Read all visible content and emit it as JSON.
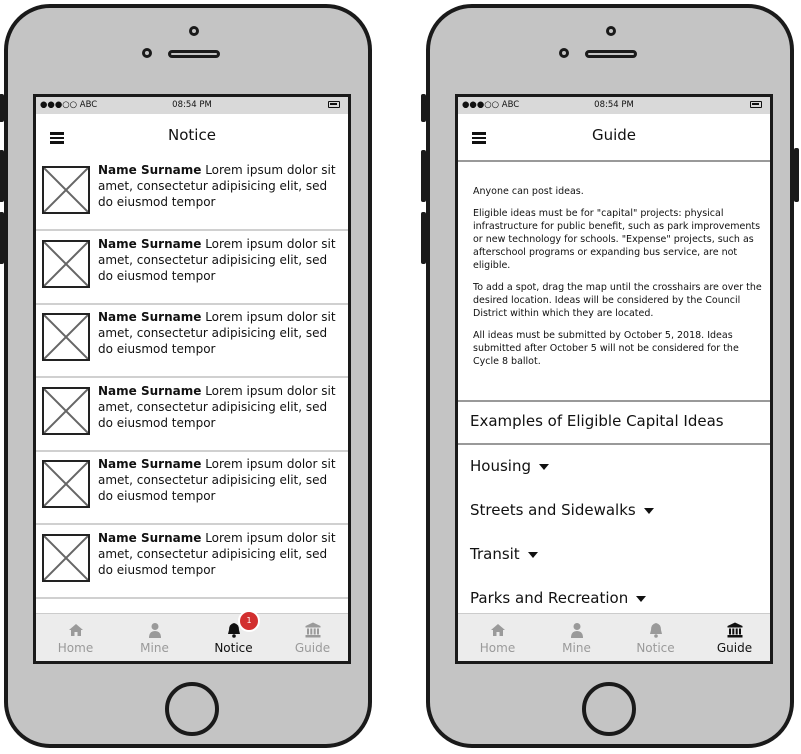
{
  "left_phone": {
    "status": {
      "carrier": "●●●○○ ABC",
      "time": "08:54 PM"
    },
    "title": "Notice",
    "items": [
      {
        "name": "Name Surname",
        "text": "Lorem ipsum dolor sit amet, consectetur adipisicing elit, sed do eiusmod tempor"
      },
      {
        "name": "Name Surname",
        "text": "Lorem ipsum dolor sit amet, consectetur adipisicing elit, sed do eiusmod tempor"
      },
      {
        "name": "Name Surname",
        "text": "Lorem ipsum dolor sit amet, consectetur adipisicing elit, sed do eiusmod tempor"
      },
      {
        "name": "Name Surname",
        "text": "Lorem ipsum dolor sit amet, consectetur adipisicing elit, sed do eiusmod tempor"
      },
      {
        "name": "Name Surname",
        "text": "Lorem ipsum dolor sit amet, consectetur adipisicing elit, sed do eiusmod tempor"
      },
      {
        "name": "Name Surname",
        "text": "Lorem ipsum dolor sit amet, consectetur adipisicing elit, sed do eiusmod tempor"
      }
    ],
    "tabs": [
      {
        "label": "Home",
        "icon": "home-icon"
      },
      {
        "label": "Mine",
        "icon": "person-icon"
      },
      {
        "label": "Notice",
        "icon": "bell-icon",
        "badge": "1"
      },
      {
        "label": "Guide",
        "icon": "bank-icon"
      }
    ],
    "active_tab": "Notice"
  },
  "right_phone": {
    "status": {
      "carrier": "●●●○○ ABC",
      "time": "08:54 PM"
    },
    "title": "Guide",
    "paragraphs": [
      "Anyone can post ideas.",
      "Eligible ideas must be for \"capital\" projects: physical infrastructure for public benefit, such as park improvements or new technology for schools. \"Expense\" projects, such as afterschool programs or expanding bus service, are not eligible.",
      "To add a spot, drag the map until the crosshairs are over the desired location. Ideas will be considered by the Council District within which they are located.",
      "All ideas must be submitted by October 5, 2018. Ideas submitted after October 5 will not be considered for the Cycle 8 ballot."
    ],
    "section_title": "Examples of Eligible Capital Ideas",
    "accordion": [
      "Housing",
      "Streets and Sidewalks",
      "Transit",
      "Parks and Recreation"
    ],
    "tabs": [
      {
        "label": "Home",
        "icon": "home-icon"
      },
      {
        "label": "Mine",
        "icon": "person-icon"
      },
      {
        "label": "Notice",
        "icon": "bell-icon"
      },
      {
        "label": "Guide",
        "icon": "bank-icon"
      }
    ],
    "active_tab": "Guide"
  },
  "colors": {
    "phone_body": "#c4c4c4",
    "badge": "#d23030",
    "inactive_tab": "#9a9a9a"
  }
}
